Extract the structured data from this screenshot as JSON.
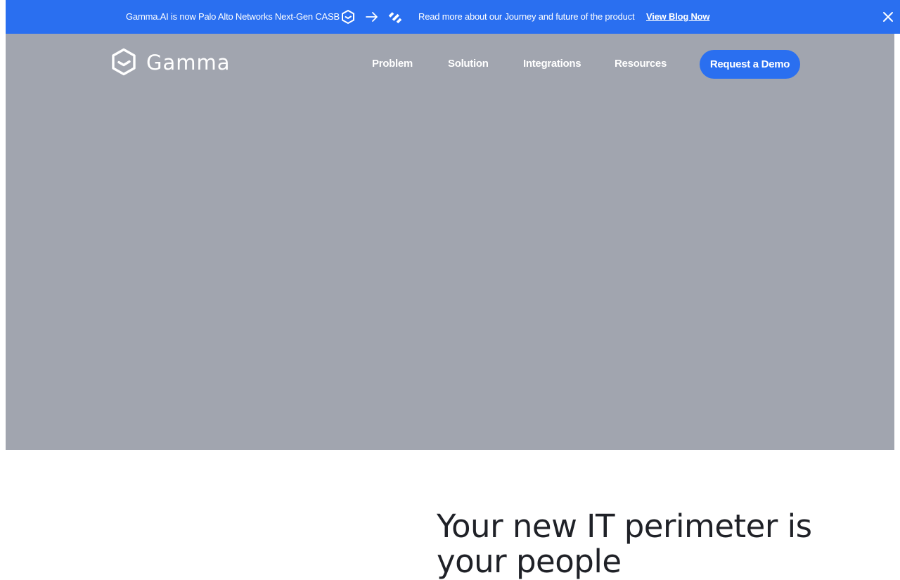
{
  "banner": {
    "announcement": "Gamma.AI is now Palo Alto Networks Next-Gen CASB",
    "read_more": "Read more about our Journey and future of the product",
    "link_label": "View Blog Now",
    "background_color": "#2a6ff0",
    "icons": [
      "gamma-logo-icon",
      "arrow-right-icon",
      "palo-alto-logo-icon",
      "close-icon"
    ]
  },
  "header": {
    "logo_text": "Gamma",
    "nav": [
      {
        "label": "Problem"
      },
      {
        "label": "Solution"
      },
      {
        "label": "Integrations"
      },
      {
        "label": "Resources"
      }
    ],
    "cta_label": "Request a Demo",
    "accent_color": "#2a6ff0"
  },
  "hero": {
    "background_color": "#a1a5af"
  },
  "main": {
    "headline": "Your new IT perimeter is your people"
  }
}
